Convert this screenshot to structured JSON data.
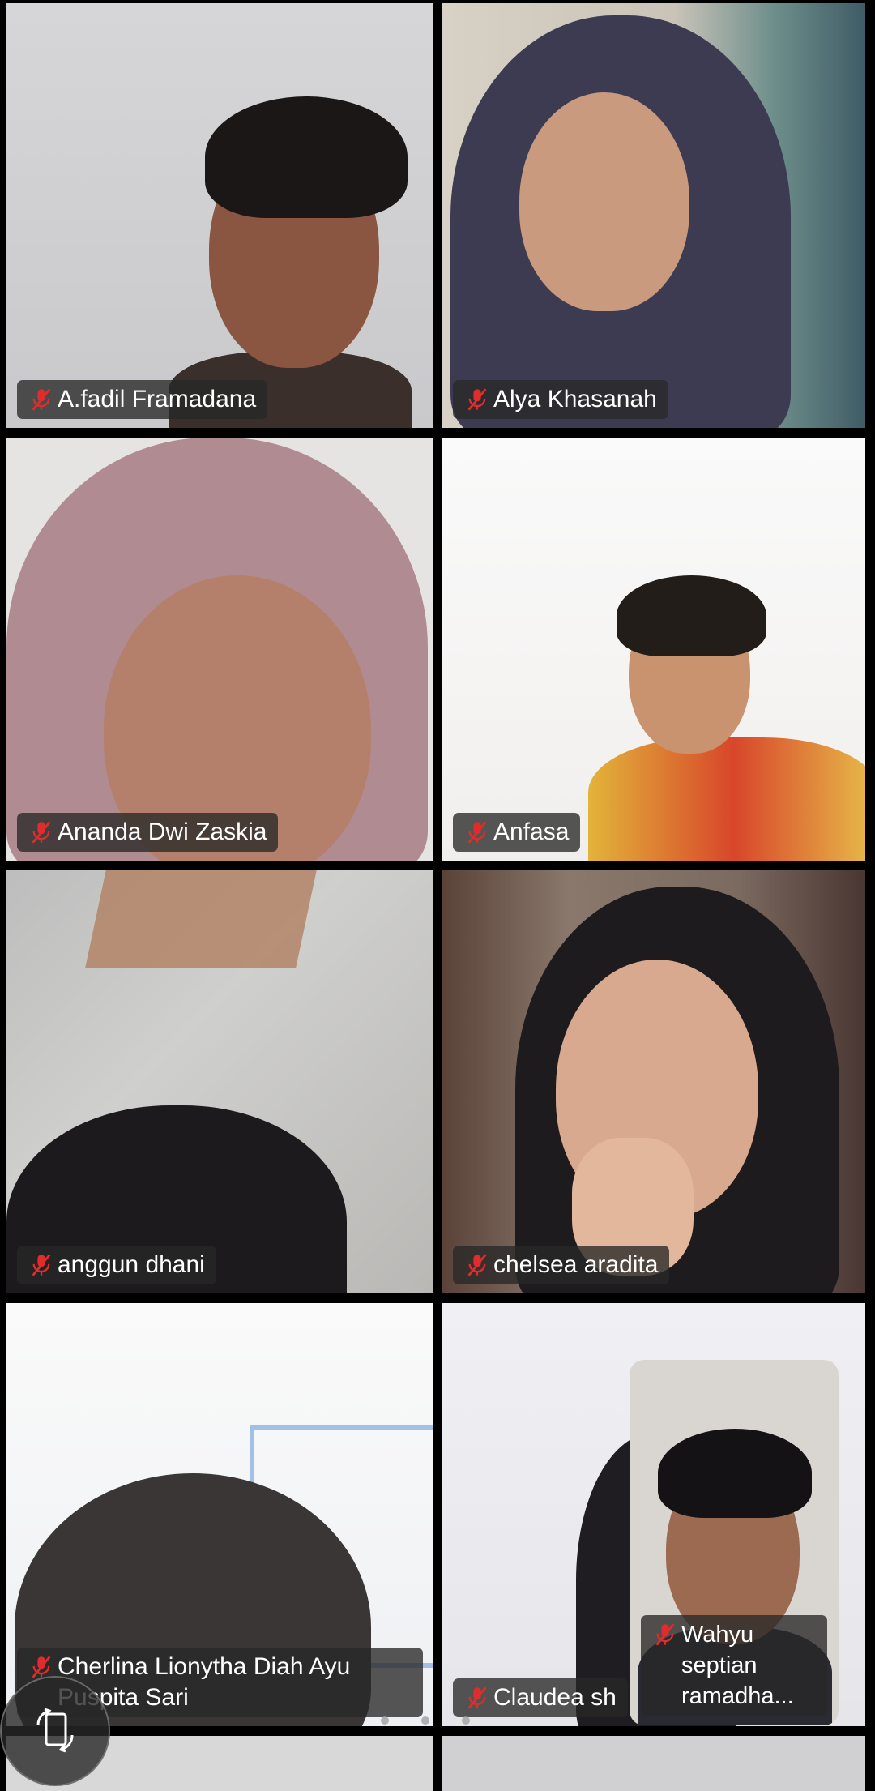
{
  "participants": [
    {
      "name": "A.fadil Framadana",
      "muted": true,
      "active_speaker": true
    },
    {
      "name": "Alya Khasanah",
      "muted": true,
      "active_speaker": false
    },
    {
      "name": "Ananda Dwi Zaskia",
      "muted": true,
      "active_speaker": false
    },
    {
      "name": "Anfasa",
      "muted": true,
      "active_speaker": false
    },
    {
      "name": "anggun dhani",
      "muted": true,
      "active_speaker": false
    },
    {
      "name": "chelsea aradita",
      "muted": true,
      "active_speaker": false
    },
    {
      "name": "Cherlina Lionytha Diah Ayu Puspita Sari",
      "muted": true,
      "active_speaker": false
    },
    {
      "name": "Claudea sh",
      "muted": true,
      "active_speaker": false
    }
  ],
  "self_view": {
    "name": "Wahyu septian ramadha...",
    "muted": true
  },
  "icons": {
    "muted_mic": "mic-off-icon",
    "rotate_screen": "screen-rotate-icon"
  },
  "colors": {
    "active_speaker_border": "#2fc14a",
    "muted_mic": "#e02c2c"
  }
}
